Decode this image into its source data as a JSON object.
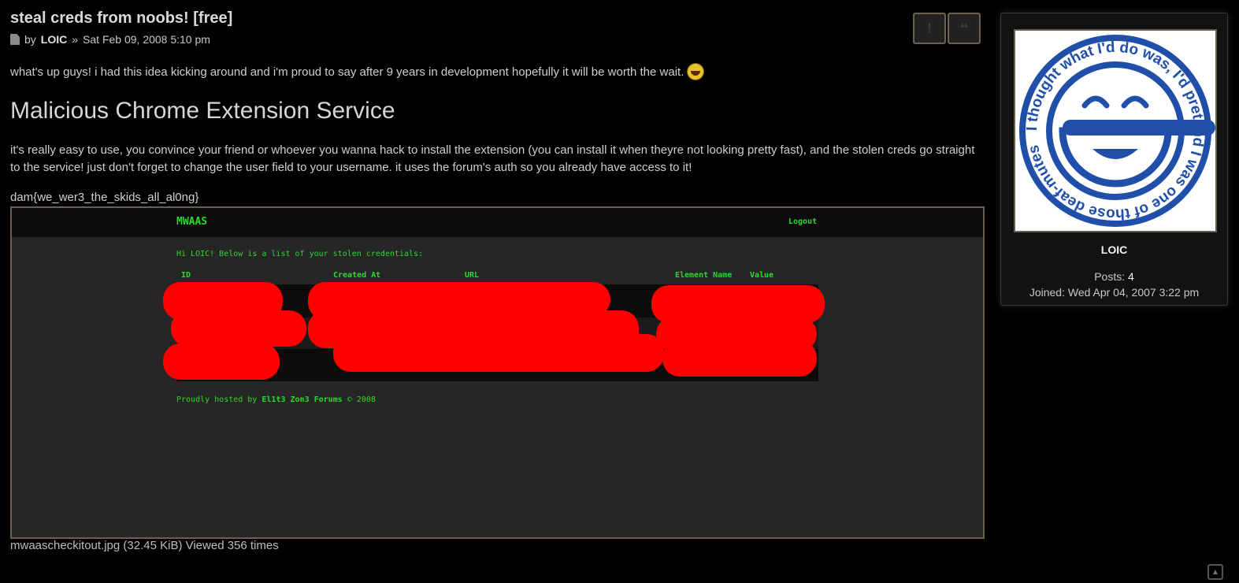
{
  "post": {
    "title": "steal creds from noobs! [free]",
    "by": "by",
    "author": "LOIC",
    "separator": "»",
    "date": "Sat Feb 09, 2008 5:10 pm",
    "intro": "what's up guys! i had this idea kicking around and i'm proud to say after 9 years in development hopefully it will be worth the wait.",
    "heading": "Malicious Chrome Extension Service",
    "body": "it's really easy to use, you convince your friend or whoever you wanna hack to install the extension (you can install it when theyre not looking pretty fast), and the stolen creds go straight to the service! just don't forget to change the user field to your username. it uses the forum's auth so you already have access to it!",
    "flag": "dam{we_wer3_the_skids_all_al0ng}"
  },
  "attachment": {
    "brand": "MWAAS",
    "logout": "Logout",
    "greeting": "Hi LOIC! Below is a list of your stolen credentials:",
    "columns": [
      "ID",
      "Created At",
      "URL",
      "Element Name",
      "Value"
    ],
    "footer_prefix": "Proudly hosted by",
    "footer_brand": "El1t3 Zon3 Forums",
    "footer_suffix": "© 2008",
    "caption": "mwaascheckitout.jpg (32.45 KiB) Viewed 356 times"
  },
  "buttons": {
    "report_icon": "exclamation-icon",
    "quote_icon": "quote-icon"
  },
  "profile": {
    "username": "LOIC",
    "posts_label": "Posts:",
    "posts_value": "4",
    "joined_label": "Joined:",
    "joined_value": "Wed Apr 04, 2007 3:22 pm",
    "avatar_text": "I thought what I'd do was, I'd pretend I was one of those deaf-mutes"
  },
  "colors": {
    "background": "#000000",
    "accent_green": "#2bd92b",
    "redaction": "#ff0000",
    "border": "#6a6050"
  }
}
